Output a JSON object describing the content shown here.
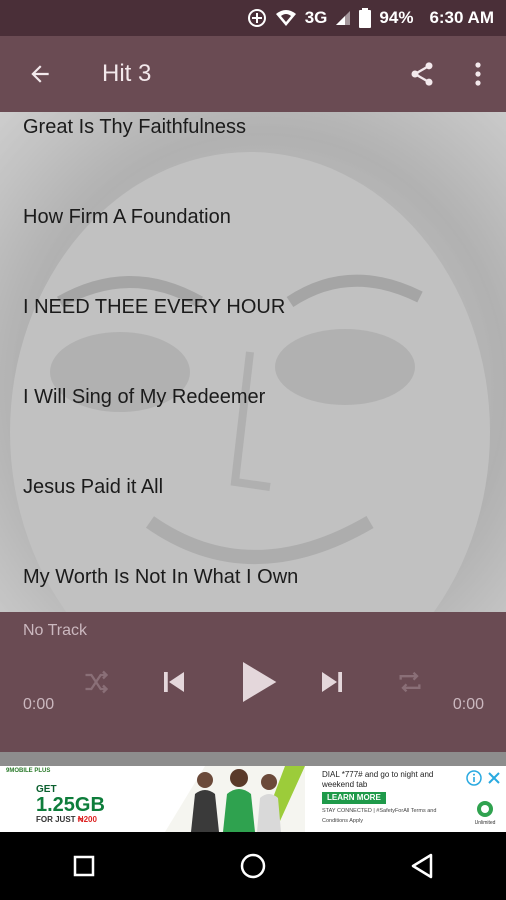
{
  "status_bar": {
    "network": "3G",
    "battery": "94%",
    "time": "6:30 AM"
  },
  "app_bar": {
    "title": "Hit 3"
  },
  "songs": [
    "Great Is Thy Faithfulness",
    "How Firm A Foundation",
    "I NEED THEE EVERY HOUR",
    "I Will Sing of My Redeemer",
    "Jesus Paid it All",
    "My Worth Is Not In What I Own"
  ],
  "player": {
    "track": "No Track",
    "elapsed": "0:00",
    "duration": "0:00"
  },
  "ad": {
    "tag": "9MOBILE PLUS",
    "get": "GET",
    "amount": "1.25GB",
    "for_just": "FOR JUST",
    "price": "₦200",
    "dial": "DIAL *777# and go to night and weekend tab",
    "learn_more": "LEARN MORE",
    "fine_print": "STAY CONNECTED | #SafetyForAll Terms and Conditions Apply",
    "brand": "Unlimited"
  },
  "colors": {
    "app_bar": "#6a4b53",
    "status_bar": "#4a2f38",
    "ad_green": "#0e7d3b"
  }
}
